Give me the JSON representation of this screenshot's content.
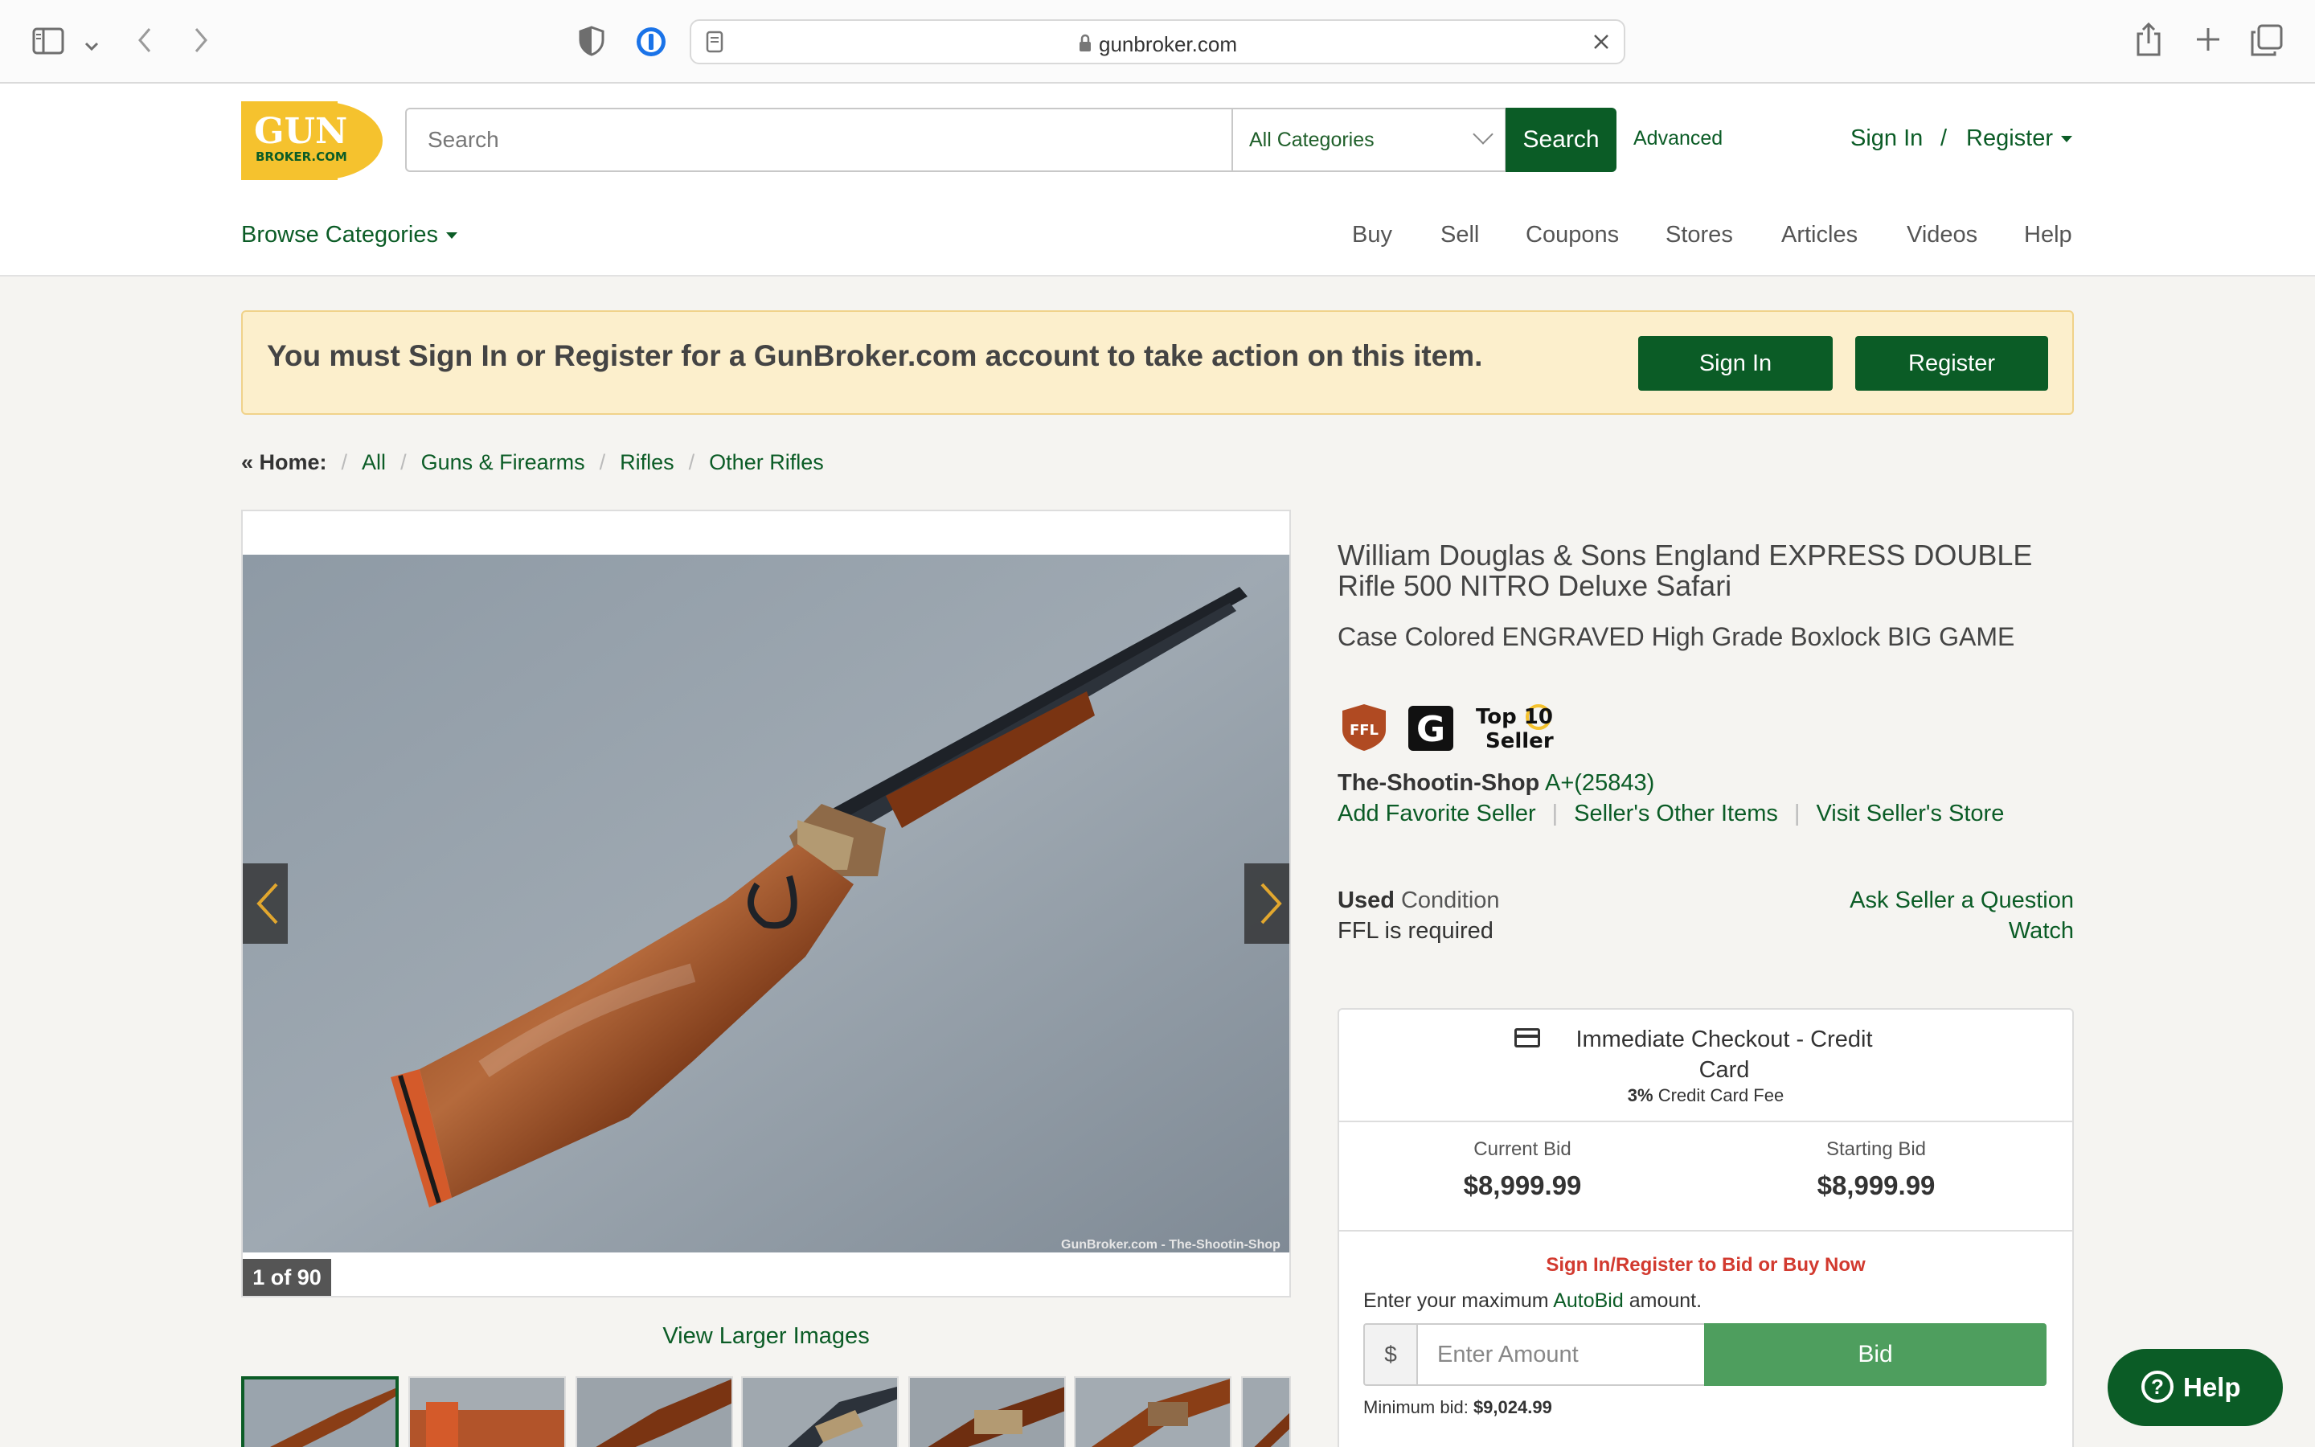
{
  "browser": {
    "url": "gunbroker.com"
  },
  "header": {
    "logo_text_top": "GUN",
    "logo_text_bottom": "BROKER.COM",
    "search_placeholder": "Search",
    "category_selected": "All Categories",
    "search_button": "Search",
    "advanced_link": "Advanced",
    "sign_in": "Sign In",
    "separator": "/",
    "register": "Register",
    "browse_categories": "Browse Categories",
    "nav": [
      "Buy",
      "Sell",
      "Coupons",
      "Stores",
      "Articles",
      "Videos",
      "Help"
    ]
  },
  "alert": {
    "message": "You must Sign In or Register for a GunBroker.com account to take action on this item.",
    "sign_in_button": "Sign In",
    "register_button": "Register"
  },
  "breadcrumb": {
    "home": "« Home:",
    "items": [
      "All",
      "Guns & Firearms",
      "Rifles",
      "Other Rifles"
    ]
  },
  "gallery": {
    "counter": "1 of 90",
    "watermark": "GunBroker.com - The-Shootin-Shop",
    "view_larger": "View Larger Images",
    "thumbnail_count": 7
  },
  "listing": {
    "title": "William Douglas & Sons England EXPRESS DOUBLE Rifle 500 NITRO Deluxe Safari",
    "subtitle": "Case Colored ENGRAVED High Grade Boxlock BIG GAME",
    "badges": {
      "ffl": "FFL",
      "g": "G",
      "top10_line1": "Top 10",
      "top10_line2": "Seller"
    },
    "seller_name": "The-Shootin-Shop",
    "seller_rating": "A+(25843)",
    "seller_links": [
      "Add Favorite Seller",
      "Seller's Other Items",
      "Visit Seller's Store"
    ],
    "condition_value": "Used",
    "condition_label": "Condition",
    "ffl_required": "FFL is required",
    "ask_seller": "Ask Seller a Question",
    "watch": "Watch"
  },
  "bid_panel": {
    "checkout_title": "Immediate Checkout - Credit Card",
    "fee_pct": "3%",
    "fee_label": "Credit Card Fee",
    "current_bid_label": "Current Bid",
    "current_bid_value": "$8,999.99",
    "starting_bid_label": "Starting Bid",
    "starting_bid_value": "$8,999.99",
    "signin_prompt": "Sign In/Register to Bid or Buy Now",
    "autobid_prefix": "Enter your maximum",
    "autobid_link": "AutoBid",
    "autobid_suffix": "amount.",
    "currency": "$",
    "amount_placeholder": "Enter Amount",
    "bid_button": "Bid",
    "min_bid_label": "Minimum bid:",
    "min_bid_value": "$9,024.99"
  },
  "help_widget": {
    "label": "Help"
  },
  "colors": {
    "brand_green": "#0b5c26",
    "bid_green": "#4e9e5e",
    "alert_bg": "#fcefcc",
    "logo_yellow": "#f5c22e",
    "warning_red": "#d23a2f"
  }
}
